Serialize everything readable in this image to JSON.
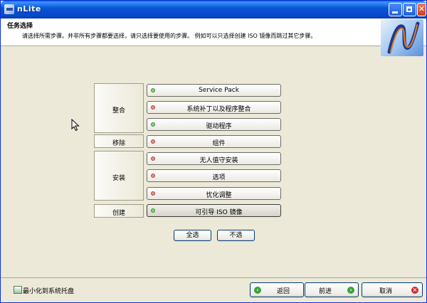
{
  "window": {
    "title": "nLite"
  },
  "header": {
    "title": "任务选择",
    "description": "请选择所需步骤。并非所有步骤都要选择，请只选择要使用的步骤。 例如可以只选择创建 ISO 镜像而跳过其它步骤。"
  },
  "groups": [
    {
      "label": "整合"
    },
    {
      "label": "移除"
    },
    {
      "label": "安装"
    },
    {
      "label": "创建"
    }
  ],
  "steps": [
    {
      "label": "Service Pack",
      "status": "green"
    },
    {
      "label": "系统补丁以及程序整合",
      "status": "red"
    },
    {
      "label": "驱动程序",
      "status": "green"
    },
    {
      "label": "组件",
      "status": "red"
    },
    {
      "label": "无人值守安装",
      "status": "red"
    },
    {
      "label": "选项",
      "status": "red"
    },
    {
      "label": "忧化调整",
      "status": "red"
    },
    {
      "label": "可引导 ISO 镜像",
      "status": "green"
    }
  ],
  "selection": {
    "select_all": "全选",
    "select_none": "不选"
  },
  "footer": {
    "minimize_to_tray": "最小化到系统托盘",
    "back": "返回",
    "next": "前进",
    "cancel": "取消"
  },
  "colors": {
    "titlebar": "#0a56d8",
    "dot_green": "#7bd86b",
    "dot_red": "#ee8a8a",
    "background": "#ece9d8"
  },
  "icons": {
    "back": "back-arrow-icon",
    "next": "next-arrow-icon",
    "cancel": "cancel-x-icon",
    "tray": "tray-icon",
    "logo": "nlite-logo-icon"
  }
}
